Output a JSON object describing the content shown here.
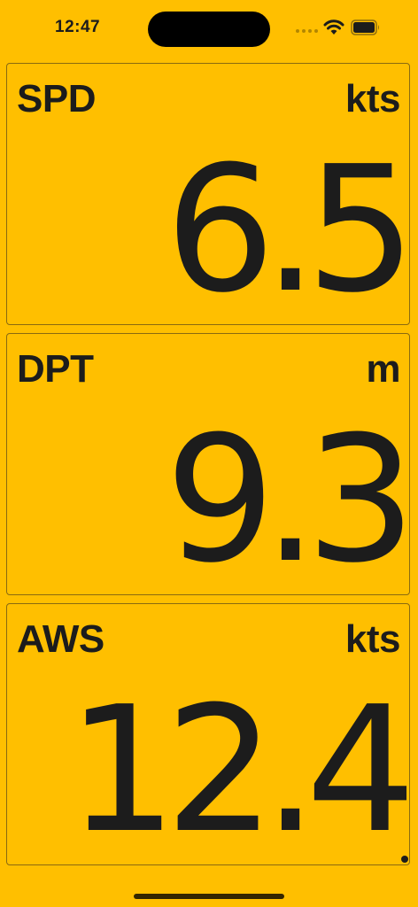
{
  "status_bar": {
    "time": "12:47",
    "icons": [
      "cellular-signal-icon",
      "wifi-icon",
      "battery-icon"
    ]
  },
  "colors": {
    "background": "#FFBF00",
    "text": "#1c1c1c",
    "panel_border": "#8a6a10"
  },
  "instruments": [
    {
      "label": "SPD",
      "unit": "kts",
      "value": "6.5"
    },
    {
      "label": "DPT",
      "unit": "m",
      "value": "9.3"
    },
    {
      "label": "AWS",
      "unit": "kts",
      "value": "12.4"
    }
  ]
}
